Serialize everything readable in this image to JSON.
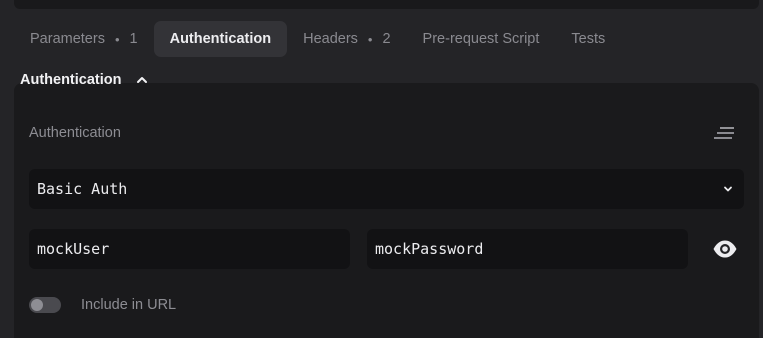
{
  "tabs": [
    {
      "label": "Parameters",
      "dot": "•",
      "count": "1"
    },
    {
      "label": "Authentication"
    },
    {
      "label": "Headers",
      "dot": "•",
      "count": "2"
    },
    {
      "label": "Pre-request Script"
    },
    {
      "label": "Tests"
    }
  ],
  "active_tab": "Authentication",
  "section": {
    "title": "Authentication",
    "chevron_icon": "chevron-up-icon"
  },
  "auth": {
    "label": "Authentication",
    "menu_icon": "lines-menu-icon",
    "type_value": "Basic Auth",
    "username_value": "mockUser",
    "password_value": "mockPassword",
    "show_password_icon": "eye-icon",
    "include_in_url_label": "Include in URL",
    "include_in_url_on": false
  },
  "colors": {
    "background": "#242427",
    "panel": "#1a1a1c",
    "field": "#121214",
    "active_tab": "#333337"
  }
}
